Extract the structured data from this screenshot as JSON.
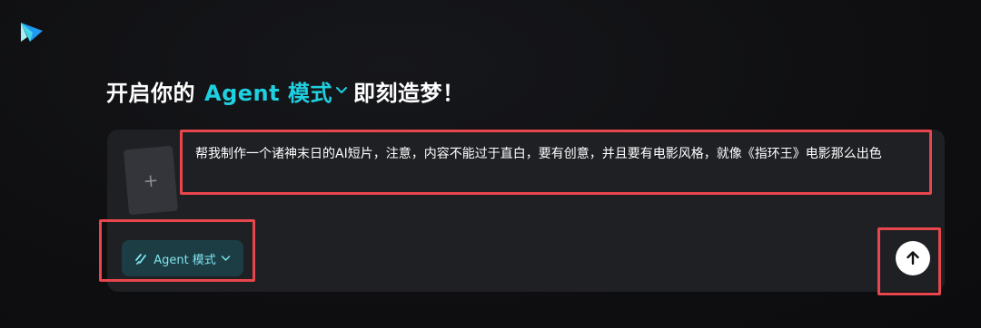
{
  "app": {
    "logo_icon": "paper-plane-logo-icon"
  },
  "headline": {
    "prefix": "开启你的",
    "mode_text": "Agent 模式",
    "suffix": "即刻造梦！",
    "accent_color": "#1fd0e0"
  },
  "composer": {
    "upload_icon": "plus-icon",
    "upload_label": "+",
    "prompt_text": "帮我制作一个诸神末日的AI短片，注意，内容不能过于直白，要有创意，并且要有电影风格，就像《指环王》电影那么出色",
    "mode_button_label": "Agent 模式",
    "mode_icon": "agent-slash-icon",
    "mode_chevron": "chevron-down-icon",
    "send_icon": "arrow-up-icon",
    "highlight_color": "#e8464d"
  }
}
